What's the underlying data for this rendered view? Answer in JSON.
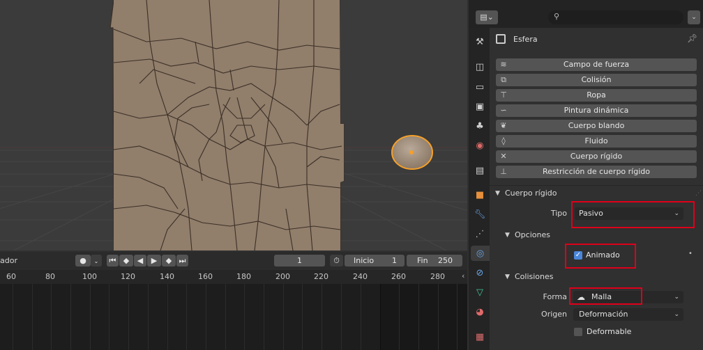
{
  "viewport": {
    "colors": {
      "background": "#3b3b3b",
      "wall": "#917e6b",
      "crack": "#3a2f26",
      "selected_outline": "#f5a02a"
    }
  },
  "timeline": {
    "mode_label": "ador",
    "current_frame": "1",
    "start_label": "Inicio",
    "start_value": "1",
    "end_label": "Fin",
    "end_value": "250",
    "ruler_ticks": [
      "60",
      "80",
      "100",
      "120",
      "140",
      "160",
      "180",
      "200",
      "220",
      "240",
      "260",
      "280"
    ]
  },
  "properties": {
    "search_placeholder": "",
    "object_name": "Esfera",
    "physics_buttons": [
      {
        "label": "Campo de fuerza",
        "icon": "force-field-icon"
      },
      {
        "label": "Colisión",
        "icon": "collision-icon"
      },
      {
        "label": "Ropa",
        "icon": "cloth-icon"
      },
      {
        "label": "Pintura dinámica",
        "icon": "dynamic-paint-icon"
      },
      {
        "label": "Cuerpo blando",
        "icon": "soft-body-icon"
      },
      {
        "label": "Fluido",
        "icon": "fluid-icon"
      },
      {
        "label": "Cuerpo rígido",
        "icon": "rigid-body-icon"
      },
      {
        "label": "Restricción de cuerpo rígido",
        "icon": "rigid-body-constraint-icon"
      }
    ],
    "rigid_body": {
      "title": "Cuerpo rígido",
      "tipo_label": "Tipo",
      "tipo_value": "Pasivo",
      "options_title": "Opciones",
      "animado_label": "Animado",
      "animado_checked": true,
      "collisions_title": "Colisiones",
      "forma_label": "Forma",
      "forma_value": "Malla",
      "origen_label": "Origen",
      "origen_value": "Deformación",
      "deformable_label": "Deformable",
      "deformable_checked": false
    },
    "tabs": [
      "tool-icon",
      "render-icon",
      "output-icon",
      "view-layer-icon",
      "scene-icon",
      "world-icon",
      "collection-icon",
      "object-icon",
      "modifier-icon",
      "particles-icon",
      "physics-icon",
      "constraints-icon",
      "data-icon",
      "material-icon",
      "texture-icon"
    ]
  }
}
